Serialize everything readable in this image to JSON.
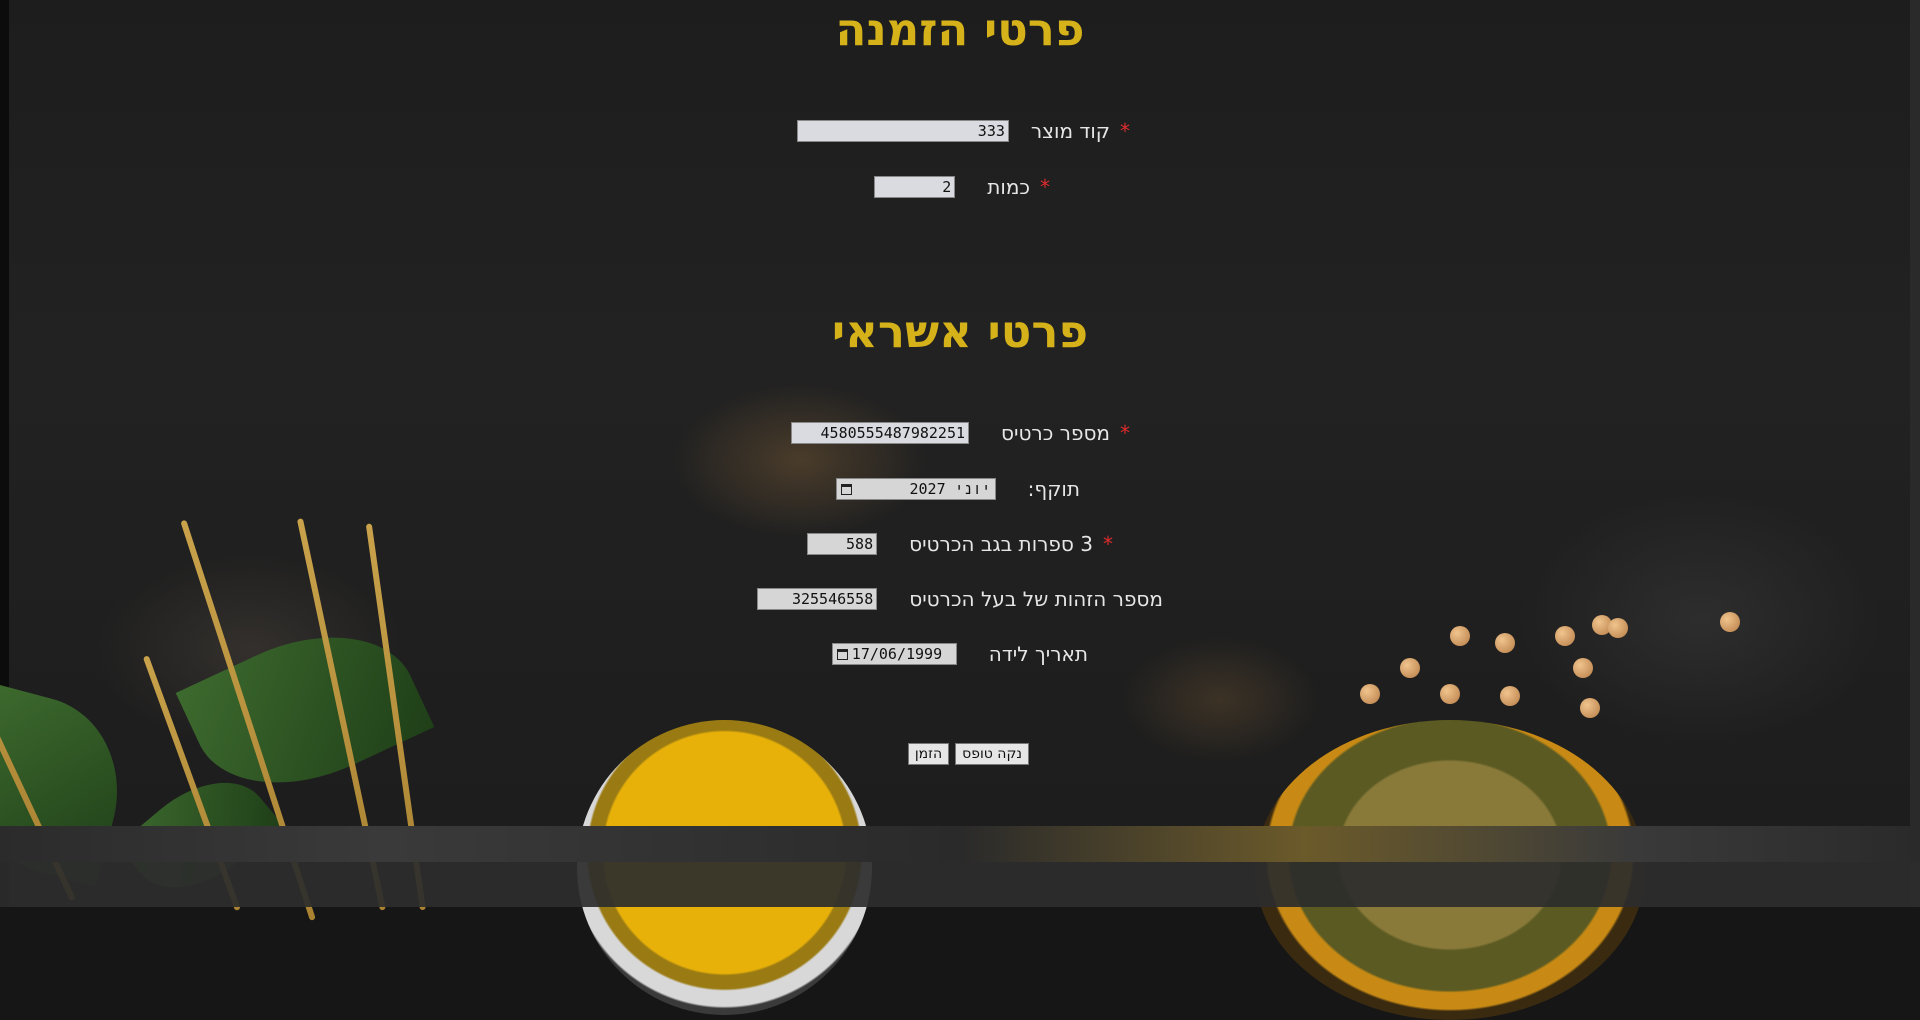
{
  "order_section": {
    "title": "פרטי הזמנה",
    "product_code": {
      "label": "קוד מוצר",
      "required_mark": "*",
      "value": "333"
    },
    "quantity": {
      "label": "כמות",
      "required_mark": "*",
      "value": "2"
    }
  },
  "credit_section": {
    "title": "פרטי אשראי",
    "card_number": {
      "label": "מספר כרטיס",
      "required_mark": "*",
      "value": "4580555487982251"
    },
    "expiry": {
      "label": "תוקף:",
      "value": "יוני 2027"
    },
    "cvv": {
      "label": "3 ספרות בגב הכרטיס",
      "required_mark": "*",
      "value": "588"
    },
    "holder_id": {
      "label": "מספר הזהות של בעל הכרטיס",
      "value": "325546558"
    },
    "birth_date": {
      "label": "תאריך לידה",
      "value": "17/06/1999"
    }
  },
  "buttons": {
    "clear": "נקה טופס",
    "order": "הזמן"
  },
  "colors": {
    "title": "#d6b21a",
    "required": "#e02b2b",
    "label": "#e6e6e6"
  }
}
